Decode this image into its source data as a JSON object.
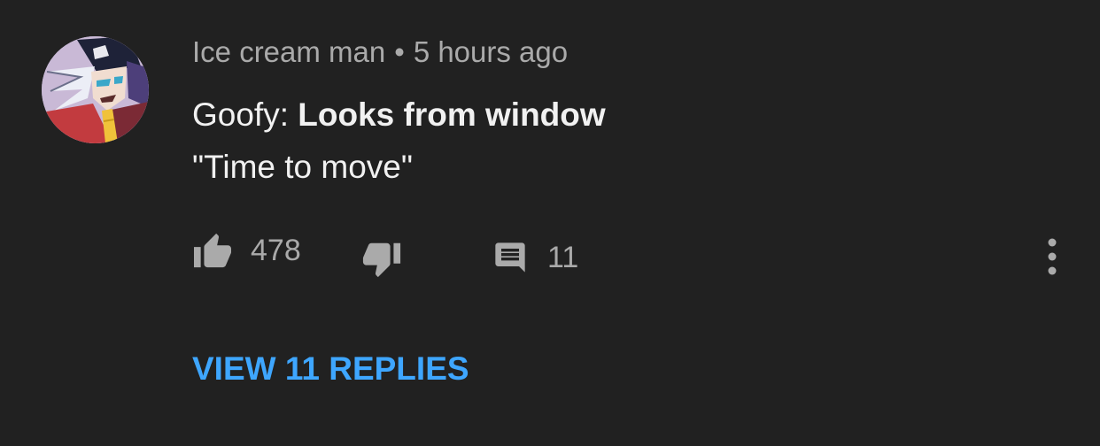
{
  "comment": {
    "author": "Ice cream man",
    "separator": "•",
    "time": "5 hours ago",
    "text_prefix": "Goofy: ",
    "text_bold": "Looks from window",
    "text_line2": "\"Time to move\"",
    "like_count": "478",
    "reply_count": "11",
    "view_replies_label": "VIEW 11 REPLIES"
  },
  "icons": {
    "like": "thumbs-up-icon",
    "dislike": "thumbs-down-icon",
    "reply": "comment-icon",
    "more": "more-vert-icon"
  },
  "colors": {
    "background": "#212121",
    "primary_text": "#f1f1f1",
    "secondary_text": "#aaaaaa",
    "link": "#3ea6ff"
  }
}
